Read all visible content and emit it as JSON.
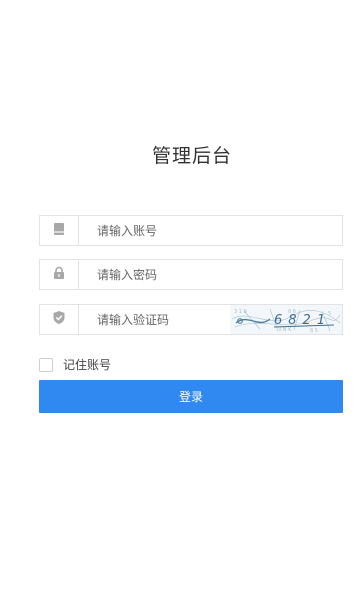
{
  "page_title": "管理后台",
  "account": {
    "icon": "account-card-icon",
    "placeholder": "请输入账号"
  },
  "password": {
    "icon": "lock-icon",
    "placeholder": "请输入密码"
  },
  "captcha": {
    "icon": "shield-check-icon",
    "placeholder": "请输入验证码",
    "code": "6821"
  },
  "remember": {
    "label": "记住账号",
    "checked": false
  },
  "login_button": {
    "label": "登录"
  },
  "colors": {
    "primary": "#2f89f0",
    "icon_gray": "#a8a8a8",
    "border": "#e3e3e3"
  }
}
